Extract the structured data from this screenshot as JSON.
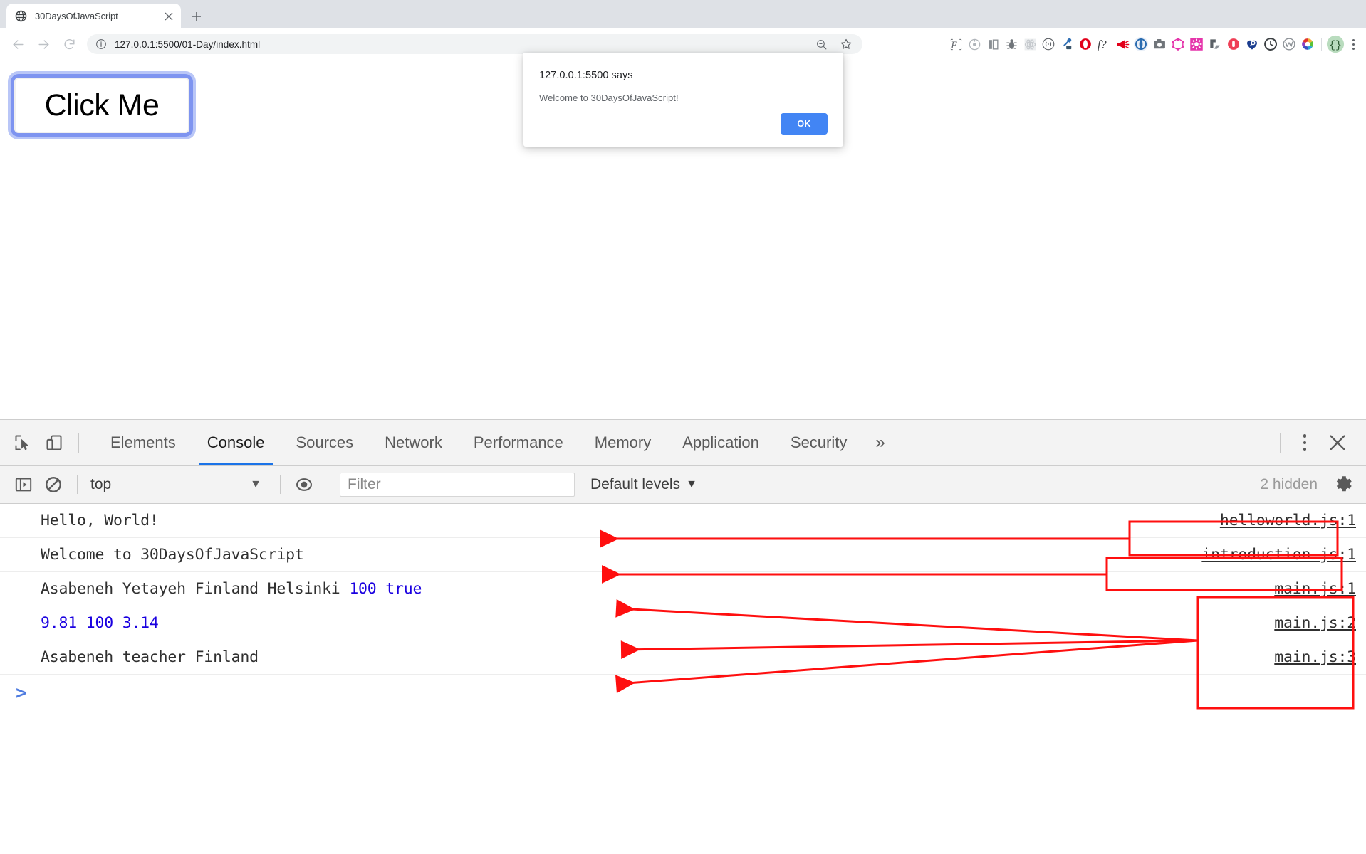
{
  "browser": {
    "tab": {
      "title": "30DaysOfJavaScript",
      "favicon": "globe-icon",
      "close": "×"
    },
    "new_tab_label": "+",
    "nav": {
      "back": "←",
      "forward": "→",
      "reload": "⟳"
    },
    "omnibox": {
      "info_icon": "info-circle-icon",
      "url_host": "127.0.0.1:5500",
      "url_path": "/01-Day/index.html",
      "url_full": "127.0.0.1:5500/01-Day/index.html",
      "zoom_icon": "zoom-magnifier-icon",
      "bookmark_icon": "star-icon"
    },
    "extensions": [
      {
        "name": "fastforward-extension-icon",
        "color": "#5f6368"
      },
      {
        "name": "target-extension-icon",
        "color": "#b0b5ba"
      },
      {
        "name": "column-split-extension-icon",
        "color": "#8a8f94"
      },
      {
        "name": "bug-extension-icon",
        "color": "#70757a"
      },
      {
        "name": "atom-react-extension-icon",
        "color": "#c5c9cd"
      },
      {
        "name": "brackets-extension-icon",
        "color": "#5f6368"
      },
      {
        "name": "eyedropper-colorpick-extension-icon",
        "color": "#2f6fb5"
      },
      {
        "name": "opera-extension-icon",
        "color": "#e2001a"
      },
      {
        "name": "fquestion-extension-icon",
        "color": "#3c4043"
      },
      {
        "name": "megaphone-extension-icon",
        "color": "#e2001a"
      },
      {
        "name": "blue-ring-extension-icon",
        "color": "#2b6cb0"
      },
      {
        "name": "camera-screenshot-extension-icon",
        "color": "#70757a"
      },
      {
        "name": "graphql-extension-icon",
        "color": "#e535ab"
      },
      {
        "name": "gear-pink-extension-icon",
        "color": "#e535ab"
      },
      {
        "name": "asana-extension-icon",
        "color": "#5a6066"
      },
      {
        "name": "pocket-extension-icon",
        "color": "#ef3f56"
      },
      {
        "name": "heart-search-extension-icon",
        "color": "#1b3d8f"
      },
      {
        "name": "clock-dark-extension-icon",
        "color": "#3c4043"
      },
      {
        "name": "wappalyzer-extension-icon",
        "color": "#8a8f94"
      },
      {
        "name": "colorwheel-extension-icon",
        "color": "#e8a33d"
      },
      {
        "name": "profile-braces-icon",
        "color": "#93c19a"
      }
    ],
    "menu": "chrome-menu-kebab-icon"
  },
  "page": {
    "button_label": "Click Me"
  },
  "alert": {
    "title": "127.0.0.1:5500 says",
    "message": "Welcome to 30DaysOfJavaScript!",
    "ok_label": "OK",
    "accent_color": "#4285f4"
  },
  "devtools": {
    "tools": [
      {
        "name": "inspect-element-icon"
      },
      {
        "name": "device-toolbar-icon"
      }
    ],
    "tabs": [
      {
        "label": "Elements",
        "active": false
      },
      {
        "label": "Console",
        "active": true
      },
      {
        "label": "Sources",
        "active": false
      },
      {
        "label": "Network",
        "active": false
      },
      {
        "label": "Performance",
        "active": false
      },
      {
        "label": "Memory",
        "active": false
      },
      {
        "label": "Application",
        "active": false
      },
      {
        "label": "Security",
        "active": false
      }
    ],
    "more_tabs_label": "»",
    "kebab": "devtools-settings-kebab-icon",
    "close": "×",
    "active_tab_underline_color": "#1a73e8",
    "console_toolbar": {
      "sidebar_toggle_icon": "console-sidebar-icon",
      "clear_icon": "clear-console-icon",
      "context_value": "top",
      "context_arrow": "▼",
      "live_expression_icon": "eye-icon",
      "filter_placeholder": "Filter",
      "filter_value": "",
      "levels_value": "Default levels",
      "levels_arrow": "▼",
      "hidden_label": "2 hidden",
      "settings_icon": "gear-icon"
    },
    "console_rows": [
      {
        "segments": [
          {
            "text": "Hello, World!",
            "type": "text"
          }
        ],
        "source": "helloworld.js:1"
      },
      {
        "segments": [
          {
            "text": "Welcome to 30DaysOfJavaScript",
            "type": "text"
          }
        ],
        "source": "introduction.js:1"
      },
      {
        "segments": [
          {
            "text": "Asabeneh Yetayeh Finland Helsinki ",
            "type": "text"
          },
          {
            "text": "100",
            "type": "num"
          },
          {
            "text": " ",
            "type": "text"
          },
          {
            "text": "true",
            "type": "bool"
          }
        ],
        "source": "main.js:1"
      },
      {
        "segments": [
          {
            "text": "9.81 100 3.14",
            "type": "num"
          }
        ],
        "source": "main.js:2"
      },
      {
        "segments": [
          {
            "text": "Asabeneh teacher Finland",
            "type": "text"
          }
        ],
        "source": "main.js:3"
      }
    ],
    "prompt_caret": ">"
  },
  "annotations": {
    "color": "#ff0f0f",
    "boxes": [
      {
        "name": "helloworld-source-highlight"
      },
      {
        "name": "introduction-source-highlight"
      },
      {
        "name": "mainjs-sources-highlight"
      }
    ],
    "arrows": [
      {
        "name": "arrow-to-helloworld-row"
      },
      {
        "name": "arrow-to-introduction-row"
      },
      {
        "name": "arrow-to-mainjs-1-row"
      },
      {
        "name": "arrow-to-mainjs-2-row"
      },
      {
        "name": "arrow-to-mainjs-3-row"
      }
    ]
  }
}
